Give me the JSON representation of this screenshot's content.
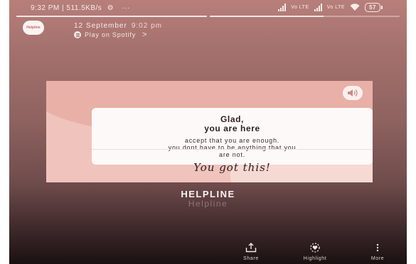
{
  "status_bar": {
    "time_info": "9:32 PM | 511.5KB/s",
    "network_labels": [
      "Vo LTE",
      "Vo LTE"
    ],
    "battery": "57"
  },
  "story": {
    "progress": [
      1,
      0.6
    ],
    "avatar_text": "Helpline",
    "date": "12 September",
    "time": "9:02 pm",
    "music_label": "Play on Spotify",
    "music_chevron": ">"
  },
  "card": {
    "title": "Glad,",
    "subtitle": "you are here",
    "body_line1": "accept that you are enough.",
    "body_line2": "you dont have to be anything that you",
    "body_line3": "are not.",
    "script_text": "You got this!"
  },
  "titles": {
    "main": "HELPLINE",
    "sub": "Helpline"
  },
  "actions": [
    {
      "label": "Share",
      "icon": "share-icon"
    },
    {
      "label": "Highlight",
      "icon": "highlight-icon"
    },
    {
      "label": "More",
      "icon": "more-icon"
    }
  ],
  "colors": {
    "background_top": "#b87f7a",
    "background_bottom": "#1a1111",
    "card": "#f0c4bc",
    "note": "#fdf9f8"
  }
}
